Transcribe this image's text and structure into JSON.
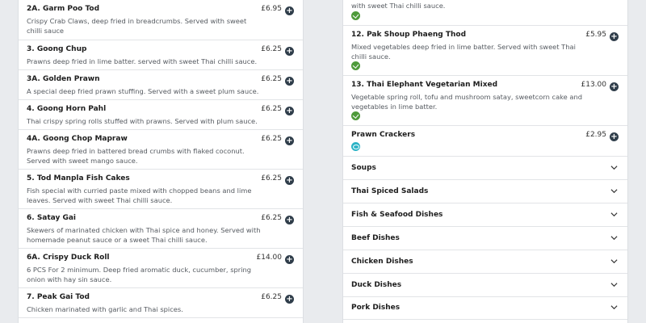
{
  "left_items": [
    {
      "name": "2A. Garm Poo Tod",
      "desc": "Crispy Crab Claws, deep fried in breadcrumbs. Served with sweet chilli sauce",
      "price": "£6.95"
    },
    {
      "name": "3. Goong Chup",
      "desc": "Prawns deep fried in lime batter. served with sweet Thai chilli sauce.",
      "price": "£6.25"
    },
    {
      "name": "3A. Golden Prawn",
      "desc": "A special deep fried prawn stuffing. Served with a sweet plum sauce.",
      "price": "£6.25"
    },
    {
      "name": "4. Goong Horn Pahl",
      "desc": "Thai crispy spring rolls stuffed with prawns. Served with plum sauce.",
      "price": "£6.25"
    },
    {
      "name": "4A. Goong Chop Mapraw",
      "desc": "Prawns deep fried in battered bread crumbs with flaked coconut. Served with sweet mango sauce.",
      "price": "£6.25"
    },
    {
      "name": "5. Tod Manpla Fish Cakes",
      "desc": "Fish special with curried paste mixed with chopped beans and lime leaves. Served with sweet Thai chilli sauce.",
      "price": "£6.25"
    },
    {
      "name": "6. Satay Gai",
      "desc": "Skewers of marinated chicken with Thai spice and honey. Served with homemade peanut sauce or a sweet Thai chilli sauce.",
      "price": "£6.25"
    },
    {
      "name": "6A. Crispy Duck Roll",
      "desc": "6 PCS For 2 minimum. Deep fried aromatic duck, cucumber, spring onion with hay sin sauce.",
      "price": "£14.00"
    },
    {
      "name": "7. Peak Gai Tod",
      "desc": "Chicken marinated with garlic and Thai spices.",
      "price": "£6.25"
    }
  ],
  "right_top_desc": "with sweet Thai chilli sauce.",
  "right_items": [
    {
      "name": "12. Pak Shoup Phaeng Thod",
      "desc": "Mixed vegetables deep fried in lime batter. Served with sweet Thai chilli sauce.",
      "price": "£5.95"
    },
    {
      "name": "13. Thai Elephant Vegetarian Mixed",
      "desc": "Vegetable spring roll, tofu and mushroom satay, sweetcorn cake and vegetables in lime batter.",
      "price": "£13.00"
    },
    {
      "name": "Prawn Crackers",
      "desc": "",
      "price": "£2.95"
    }
  ],
  "add_symbol": "+",
  "icons": {
    "vegetarian": "vegetarian-icon",
    "seafood": "seafood-icon",
    "add": "plus-icon",
    "expand": "chevron-down-icon"
  },
  "colors": {
    "add_button": "#2f3d4a",
    "vegetarian": "#4e9a3a",
    "seafood": "#2bb3c6"
  },
  "categories": [
    "Soups",
    "Thai Spiced Salads",
    "Fish & Seafood Dishes",
    "Beef Dishes",
    "Chicken Dishes",
    "Duck Dishes",
    "Pork Dishes"
  ]
}
